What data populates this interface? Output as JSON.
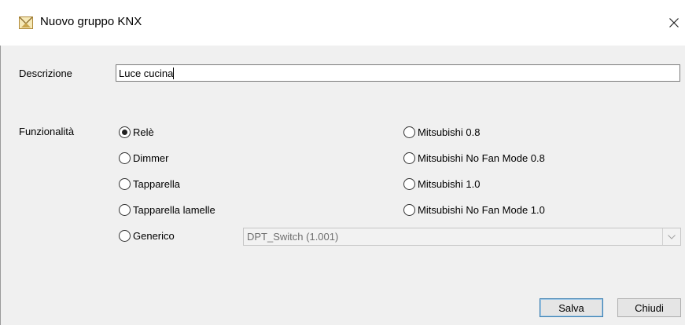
{
  "window": {
    "title": "Nuovo gruppo KNX",
    "close_glyph": "✕"
  },
  "form": {
    "description_label": "Descrizione",
    "description_value": "Luce cucina",
    "functionality_label": "Funzionalità",
    "options": [
      {
        "label": "Relè",
        "checked": true
      },
      {
        "label": "Dimmer",
        "checked": false
      },
      {
        "label": "Tapparella",
        "checked": false
      },
      {
        "label": "Tapparella lamelle",
        "checked": false
      },
      {
        "label": "Generico",
        "checked": false
      },
      {
        "label": "Mitsubishi 0.8",
        "checked": false
      },
      {
        "label": "Mitsubishi No Fan Mode 0.8",
        "checked": false
      },
      {
        "label": "Mitsubishi 1.0",
        "checked": false
      },
      {
        "label": "Mitsubishi No Fan Mode 1.0",
        "checked": false
      }
    ],
    "generic_type": {
      "value": "DPT_Switch (1.001)",
      "enabled": false
    }
  },
  "buttons": {
    "save": "Salva",
    "close": "Chiudi"
  },
  "icons": {
    "app": "knx-app-icon",
    "close": "close-icon",
    "dropdown": "chevron-down-icon"
  },
  "colors": {
    "background": "#f0f0f0",
    "titlebar": "#ffffff",
    "primary_button_border": "#3c7fb1"
  }
}
